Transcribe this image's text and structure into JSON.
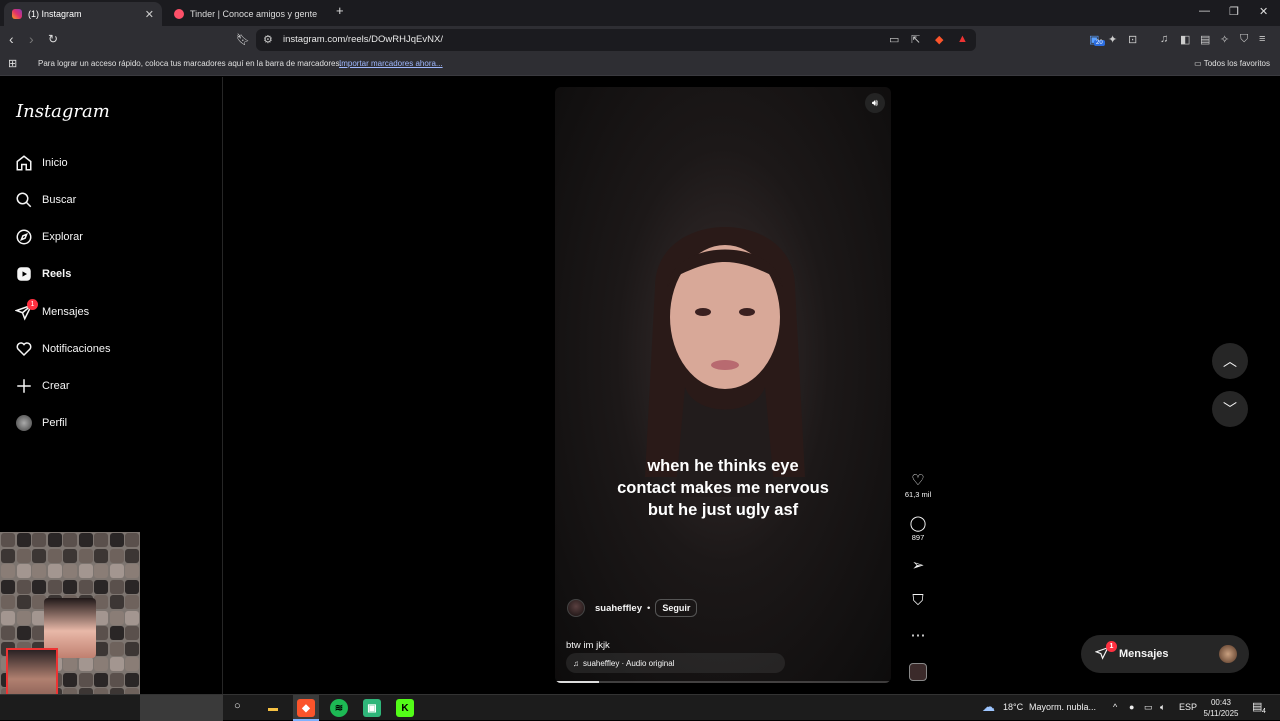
{
  "browser": {
    "tabs": [
      {
        "title": "(1) Instagram",
        "active": true
      },
      {
        "title": "Tinder | Conoce amigos y gente nue",
        "active": false
      }
    ],
    "new_tab": "+",
    "url": "instagram.com/reels/DOwRHJqEvNX/",
    "bookmarks_hint": "Para lograr un acceso rápido, coloca tus marcadores aquí en la barra de marcadores.",
    "bookmarks_import": "Importar marcadores ahora...",
    "all_favorites": "Todos los favoritos",
    "extension_count": "20"
  },
  "sidebar": {
    "logo": "Instagram",
    "items": [
      {
        "label": "Inicio",
        "icon": "home-icon"
      },
      {
        "label": "Buscar",
        "icon": "search-icon"
      },
      {
        "label": "Explorar",
        "icon": "compass-icon"
      },
      {
        "label": "Reels",
        "icon": "reels-icon"
      },
      {
        "label": "Mensajes",
        "icon": "messages-icon",
        "badge": "1"
      },
      {
        "label": "Notificaciones",
        "icon": "heart-icon"
      },
      {
        "label": "Crear",
        "icon": "plus-icon"
      },
      {
        "label": "Perfil",
        "icon": "avatar"
      }
    ]
  },
  "reel": {
    "overlay_text": [
      "when he thinks eye",
      "contact makes me nervous",
      "but he just ugly asf"
    ],
    "author": "suaheffley",
    "dot": "•",
    "follow": "Seguir",
    "caption": "btw im jkjk",
    "audio": "suaheffley · Audio original",
    "progress": 0.13,
    "likes": "61,3 mil",
    "comments": "897"
  },
  "messages_pill": {
    "label": "Mensajes",
    "badge": "1"
  },
  "taskbar": {
    "weather": "18°C",
    "weather_text": "Mayorm. nubla...",
    "lang": "ESP",
    "time": "00:43",
    "date": "5/11/2025",
    "notifications": "4"
  }
}
